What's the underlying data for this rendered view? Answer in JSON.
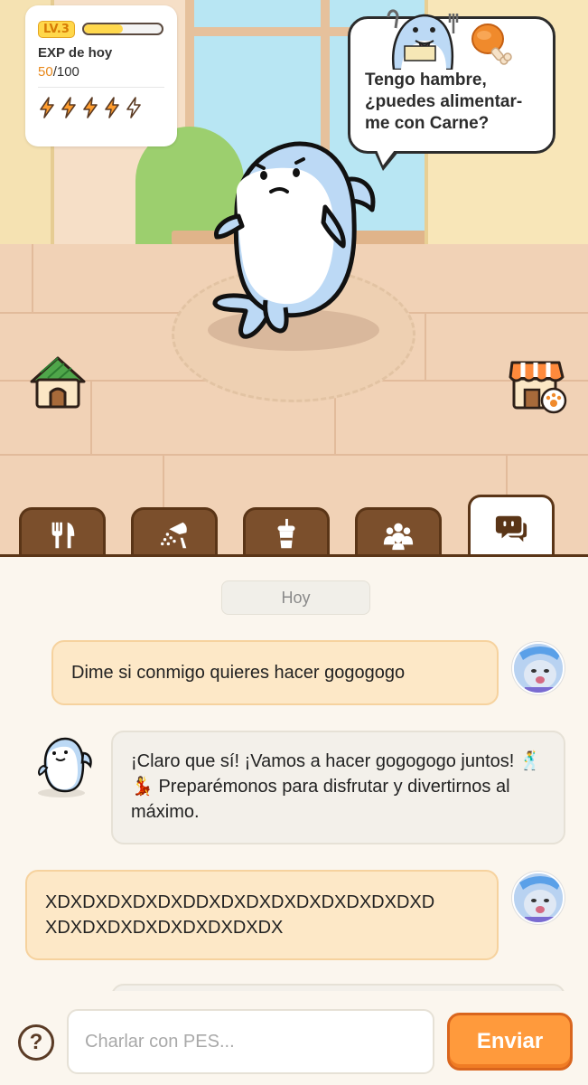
{
  "status": {
    "level": "LV.3",
    "exp_progress": 0.5,
    "exp_label": "EXP de hoy",
    "exp_current": "50",
    "exp_max": "/100",
    "energy_bolts": 5
  },
  "speech_bubble": {
    "text": "Tengo hambre, ¿puedes alimentar-me con Carne?",
    "food_icon": "meat-icon"
  },
  "side_buttons": {
    "home": "house-icon",
    "shop": "shop-icon"
  },
  "tabs": [
    {
      "name": "feed",
      "icon": "fork-knife-icon",
      "active": false
    },
    {
      "name": "wash",
      "icon": "shower-icon",
      "active": false
    },
    {
      "name": "drink",
      "icon": "cup-icon",
      "active": false
    },
    {
      "name": "friends",
      "icon": "people-icon",
      "active": false
    },
    {
      "name": "chat",
      "icon": "chat-bubble-icon",
      "active": true
    }
  ],
  "chat": {
    "date_label": "Hoy",
    "messages": [
      {
        "sender": "user",
        "text": "Dime si conmigo quieres hacer gogogogo"
      },
      {
        "sender": "pet",
        "text": "¡Claro que sí! ¡Vamos a hacer gogogogo juntos! 🕺💃 Preparémonos para disfrutar y divertirnos al máximo."
      },
      {
        "sender": "user",
        "text": "XDXDXDXDXDXDDXDXDXDXDXDXDXDXDXD XDXDXDXDXDXDXDXDXDX"
      },
      {
        "sender": "pet",
        "text": ""
      }
    ]
  },
  "input": {
    "placeholder": "Charlar con PES...",
    "value": "",
    "send_label": "Enviar",
    "help_label": "?"
  },
  "colors": {
    "accent_orange": "#ff9a3c",
    "tab_brown": "#7b4f2c",
    "user_bubble": "#fde8c7",
    "pet_bubble": "#f3f0ea",
    "exp_orange": "#e8891d"
  }
}
